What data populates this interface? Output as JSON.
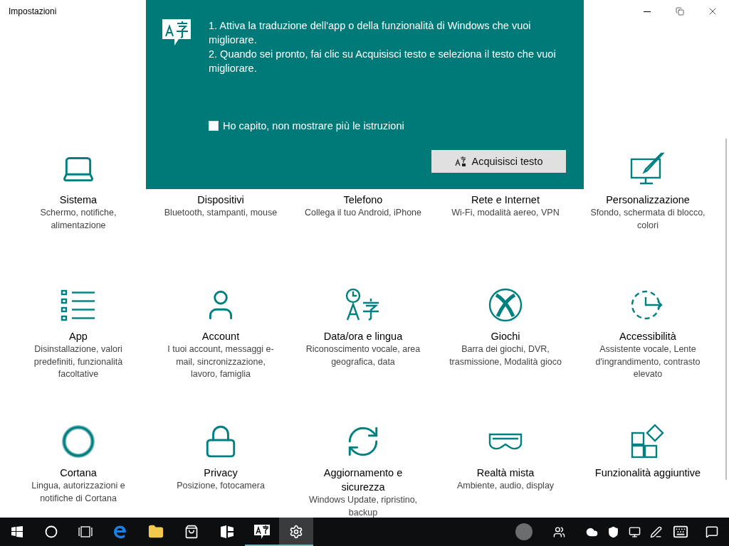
{
  "window": {
    "title": "Impostazioni"
  },
  "tip_panel": {
    "steps": [
      "1. Attiva la traduzione dell'app o della funzionalità di Windows che vuoi migliorare.",
      "2. Quando sei pronto, fai clic su Acquisisci testo e seleziona il testo che vuoi migliorare."
    ],
    "checkbox": {
      "label": "Ho capito, non mostrare più le istruzioni",
      "checked": false
    },
    "button": "Acquisisci testo"
  },
  "categories": [
    {
      "kind": "laptop",
      "name": "Sistema",
      "description": "Schermo, notifiche, alimentazione"
    },
    {
      "kind": "none",
      "name": "Dispositivi",
      "description": "Bluetooth, stampanti, mouse"
    },
    {
      "kind": "none",
      "name": "Telefono",
      "description": "Collega il tuo Android, iPhone"
    },
    {
      "kind": "none",
      "name": "Rete e Internet",
      "description": "Wi-Fi, modalità aereo, VPN"
    },
    {
      "kind": "paint",
      "name": "Personalizzazione",
      "description": "Sfondo, schermata di blocco, colori"
    },
    {
      "kind": "list",
      "name": "App",
      "description": "Disinstallazione, valori predefiniti, funzionalità facoltative"
    },
    {
      "kind": "person",
      "name": "Account",
      "description": "I tuoi account, messaggi e-mail, sincronizzazione, lavoro, famiglia"
    },
    {
      "kind": "language",
      "name": "Data/ora e lingua",
      "description": "Riconoscimento vocale, area geografica, data"
    },
    {
      "kind": "xbox",
      "name": "Giochi",
      "description": "Barra dei giochi, DVR, trasmissione, Modalità gioco"
    },
    {
      "kind": "access",
      "name": "Accessibilità",
      "description": "Assistente vocale, Lente d'ingrandimento, contrasto elevato"
    },
    {
      "kind": "cortana",
      "name": "Cortana",
      "description": "Lingua, autorizzazioni e notifiche di Cortana"
    },
    {
      "kind": "lock",
      "name": "Privacy",
      "description": "Posizione, fotocamera"
    },
    {
      "kind": "update",
      "name": "Aggiornamento e sicurezza",
      "description": "Windows Update, ripristino, backup"
    },
    {
      "kind": "headset",
      "name": "Realtà mista",
      "description": "Ambiente, audio, display"
    },
    {
      "kind": "addons",
      "name": "Funzionalità aggiuntive"
    }
  ],
  "taskbar": {
    "apps": [
      {
        "kind": "edge",
        "running": false,
        "selected": false
      },
      {
        "kind": "folder",
        "running": false,
        "selected": false
      },
      {
        "kind": "store",
        "running": false,
        "selected": false
      },
      {
        "kind": "tablet",
        "running": false,
        "selected": false
      },
      {
        "kind": "translator",
        "running": true,
        "selected": false
      },
      {
        "kind": "settings",
        "running": true,
        "selected": true
      }
    ]
  }
}
